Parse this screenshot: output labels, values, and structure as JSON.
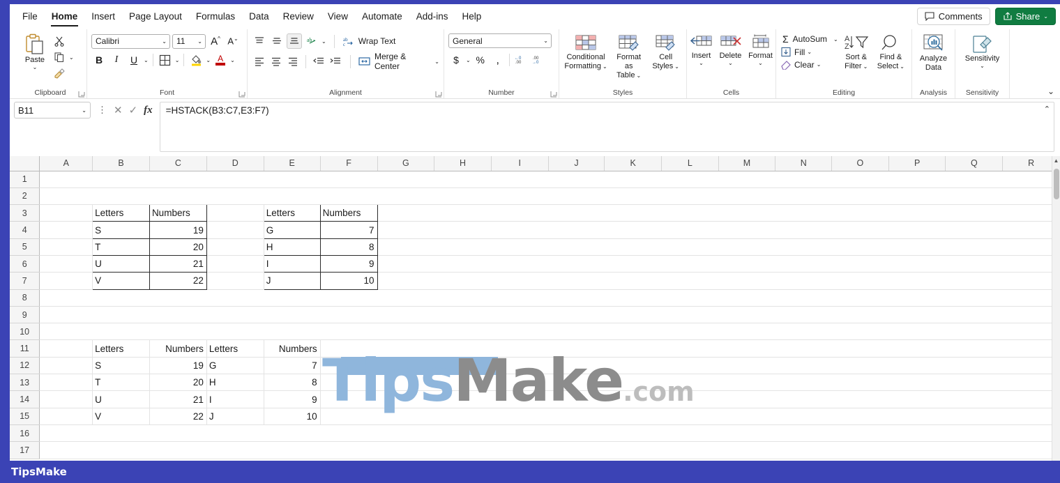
{
  "menu": {
    "items": [
      {
        "label": "File",
        "active": false
      },
      {
        "label": "Home",
        "active": true
      },
      {
        "label": "Insert",
        "active": false
      },
      {
        "label": "Page Layout",
        "active": false
      },
      {
        "label": "Formulas",
        "active": false
      },
      {
        "label": "Data",
        "active": false
      },
      {
        "label": "Review",
        "active": false
      },
      {
        "label": "View",
        "active": false
      },
      {
        "label": "Automate",
        "active": false
      },
      {
        "label": "Add-ins",
        "active": false
      },
      {
        "label": "Help",
        "active": false
      }
    ],
    "comments_label": "Comments",
    "share_label": "Share"
  },
  "ribbon": {
    "clipboard": {
      "group_label": "Clipboard",
      "paste_label": "Paste",
      "cut_icon": "scissors-icon",
      "copy_icon": "copy-icon",
      "format_painter_icon": "format-painter-icon"
    },
    "font": {
      "group_label": "Font",
      "font_name": "Calibri",
      "font_size": "11",
      "bold_label": "B",
      "italic_label": "I",
      "underline_label": "U",
      "grow_label": "A",
      "shrink_label": "A",
      "borders_icon": "borders-icon",
      "fill_color_icon": "fill-color-icon",
      "font_color_label": "A"
    },
    "alignment": {
      "group_label": "Alignment",
      "wrap_text_label": "Wrap Text",
      "merge_center_label": "Merge & Center",
      "orientation_icon": "orientation-icon",
      "decrease_indent_icon": "decrease-indent-icon",
      "increase_indent_icon": "increase-indent-icon"
    },
    "number": {
      "group_label": "Number",
      "format_value": "General",
      "currency_label": "$",
      "percent_label": "%",
      "comma_label": ",",
      "inc_dec_icon": "increase-decimal-icon",
      "dec_dec_icon": "decrease-decimal-icon"
    },
    "styles": {
      "group_label": "Styles",
      "conditional_formatting": "Conditional\nFormatting",
      "conditional_formatting_l1": "Conditional",
      "conditional_formatting_l2": "Formatting",
      "format_as_table_l1": "Format as",
      "format_as_table_l2": "Table",
      "cell_styles_l1": "Cell",
      "cell_styles_l2": "Styles"
    },
    "cells": {
      "group_label": "Cells",
      "insert_label": "Insert",
      "delete_label": "Delete",
      "format_label": "Format"
    },
    "editing": {
      "group_label": "Editing",
      "autosum_label": "AutoSum",
      "fill_label": "Fill",
      "clear_label": "Clear",
      "sort_filter_l1": "Sort &",
      "sort_filter_l2": "Filter",
      "find_select_l1": "Find &",
      "find_select_l2": "Select"
    },
    "analysis": {
      "group_label": "Analysis",
      "analyze_data_l1": "Analyze",
      "analyze_data_l2": "Data"
    },
    "sensitivity": {
      "group_label": "Sensitivity",
      "sensitivity_label": "Sensitivity"
    }
  },
  "formula_bar": {
    "name_box": "B11",
    "formula": "=HSTACK(B3:C7,E3:F7)",
    "cancel_icon": "cancel-icon",
    "enter_icon": "enter-icon",
    "fx_icon": "insert-function-icon"
  },
  "sheet": {
    "columns": [
      "A",
      "B",
      "C",
      "D",
      "E",
      "F",
      "G",
      "H",
      "I",
      "J",
      "K",
      "L",
      "M",
      "N",
      "O",
      "P",
      "Q",
      "R"
    ],
    "rows": [
      "1",
      "2",
      "3",
      "4",
      "5",
      "6",
      "7",
      "8",
      "9",
      "10",
      "11",
      "12",
      "13",
      "14",
      "15",
      "16",
      "17"
    ],
    "source_table_1": {
      "range": "B3:C7",
      "headers": [
        "Letters",
        "Numbers"
      ],
      "rows": [
        [
          "S",
          "19"
        ],
        [
          "T",
          "20"
        ],
        [
          "U",
          "21"
        ],
        [
          "V",
          "22"
        ]
      ]
    },
    "source_table_2": {
      "range": "E3:F7",
      "headers": [
        "Letters",
        "Numbers"
      ],
      "rows": [
        [
          "G",
          "7"
        ],
        [
          "H",
          "8"
        ],
        [
          "I",
          "9"
        ],
        [
          "J",
          "10"
        ]
      ]
    },
    "result_table": {
      "range": "B11:E15",
      "headers": [
        "Letters",
        "Numbers",
        "Letters",
        "Numbers"
      ],
      "rows": [
        [
          "S",
          "19",
          "G",
          "7"
        ],
        [
          "T",
          "20",
          "H",
          "8"
        ],
        [
          "U",
          "21",
          "I",
          "9"
        ],
        [
          "V",
          "22",
          "J",
          "10"
        ]
      ]
    }
  },
  "watermark": {
    "part1": "Tips",
    "part2": "Make",
    "part3": ".com"
  },
  "bottom_bar": {
    "brand": "TipsMake"
  },
  "colors": {
    "accent_blue": "#3b43b5",
    "share_green": "#107c41",
    "watermark_blue": "#8fb6dc",
    "watermark_gray": "#8c8c8c"
  }
}
